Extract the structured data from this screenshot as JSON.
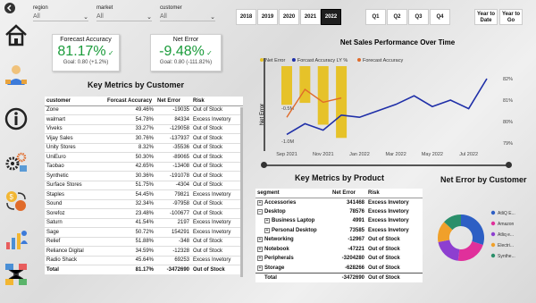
{
  "filters": [
    {
      "label": "region",
      "value": "All"
    },
    {
      "label": "market",
      "value": "All"
    },
    {
      "label": "customer",
      "value": "All"
    }
  ],
  "years": [
    "2018",
    "2019",
    "2020",
    "2021",
    "2022"
  ],
  "selected_year": "2022",
  "quarters": [
    "Q1",
    "Q2",
    "Q3",
    "Q4"
  ],
  "period_buttons": [
    "Year to Date",
    "Year to Go"
  ],
  "nav": [
    "back-icon",
    "home-icon",
    "user-icon",
    "info-icon",
    "gears-icon",
    "money-exchange-icon",
    "people-chart-icon",
    "network-icon"
  ],
  "kpis": {
    "forecast_accuracy": {
      "title": "Forecast Accuracy",
      "value": "81.17%",
      "goal": "Goal: 0.80 (+1.2%)",
      "color": "#1a9b3a"
    },
    "net_error": {
      "title": "Net Error",
      "value": "-9.48%",
      "goal": "Goal: 0.80 (-111.82%)",
      "color": "#1a9b3a"
    }
  },
  "customer_table": {
    "title": "Key Metrics by Customer",
    "headers": [
      "customer",
      "Forcast Accuracy",
      "Net Error",
      "Risk"
    ],
    "rows": [
      [
        "Zone",
        "49.46%",
        "-19035",
        "Out of Stock"
      ],
      [
        "walmart",
        "54.78%",
        "84334",
        "Excess Invetory"
      ],
      [
        "Viveks",
        "33.27%",
        "-129058",
        "Out of Stock"
      ],
      [
        "Vijay Sales",
        "30.76%",
        "-137937",
        "Out of Stock"
      ],
      [
        "Unity Stores",
        "8.32%",
        "-35536",
        "Out of Stock"
      ],
      [
        "UniEuro",
        "50.30%",
        "-89065",
        "Out of Stock"
      ],
      [
        "Taobao",
        "42.65%",
        "-13408",
        "Out of Stock"
      ],
      [
        "Synthetic",
        "30.36%",
        "-191078",
        "Out of Stock"
      ],
      [
        "Surface Stores",
        "51.75%",
        "-4304",
        "Out of Stock"
      ],
      [
        "Staples",
        "54.45%",
        "79821",
        "Excess Invetory"
      ],
      [
        "Sound",
        "32.34%",
        "-97958",
        "Out of Stock"
      ],
      [
        "Sorefoz",
        "23.48%",
        "-100677",
        "Out of Stock"
      ],
      [
        "Saturn",
        "41.54%",
        "2197",
        "Excess Invetory"
      ],
      [
        "Sage",
        "50.72%",
        "154291",
        "Excess Invetory"
      ],
      [
        "Relief",
        "51.88%",
        "-348",
        "Out of Stock"
      ],
      [
        "Reliance Digital",
        "34.59%",
        "-12328",
        "Out of Stock"
      ],
      [
        "Radio Shack",
        "45.64%",
        "69253",
        "Excess Invetory"
      ]
    ],
    "total": [
      "Total",
      "81.17%",
      "-3472690",
      "Out of Stock"
    ]
  },
  "product_table": {
    "title": "Key Metrics by Product",
    "headers": [
      "segment",
      "Net Error",
      "Risk"
    ],
    "rows": [
      {
        "name": "Accessories",
        "indent": 0,
        "expander": "+",
        "net_error": "341468",
        "risk": "Excess Invetory"
      },
      {
        "name": "Desktop",
        "indent": 0,
        "expander": "−",
        "net_error": "78576",
        "risk": "Excess Invetory"
      },
      {
        "name": "Business Laptop",
        "indent": 1,
        "expander": "+",
        "net_error": "4991",
        "risk": "Excess Invetory"
      },
      {
        "name": "Personal Desktop",
        "indent": 1,
        "expander": "+",
        "net_error": "73585",
        "risk": "Excess Invetory"
      },
      {
        "name": "Networking",
        "indent": 0,
        "expander": "+",
        "net_error": "-12967",
        "risk": "Out of Stock"
      },
      {
        "name": "Notebook",
        "indent": 0,
        "expander": "+",
        "net_error": "-47221",
        "risk": "Out of Stock"
      },
      {
        "name": "Peripherals",
        "indent": 0,
        "expander": "+",
        "net_error": "-3204280",
        "risk": "Out of Stock"
      },
      {
        "name": "Storage",
        "indent": 0,
        "expander": "+",
        "net_error": "-628266",
        "risk": "Out of Stock"
      }
    ],
    "total": {
      "name": "Total",
      "net_error": "-3472690",
      "risk": "Out of Stock"
    }
  },
  "chart_data": [
    {
      "type": "bar",
      "title": "Net Sales Performance Over Time",
      "legend": [
        "Net Error",
        "Forcast Accuracy LY %",
        "Forecast Accuracy"
      ],
      "legend_colors": [
        "#e6c229",
        "#1f2fa8",
        "#e06b2a"
      ],
      "x_ticks": [
        "Sep 2021",
        "Nov 2021",
        "Jan 2022",
        "Mar 2022",
        "May 2022",
        "Jul 2022"
      ],
      "ylabel": "Net Error",
      "y_left_ticks": [
        "0.0M",
        "-0.5M",
        "-1.0M"
      ],
      "y_right_ticks": [
        "82%",
        "81%",
        "80%",
        "79%"
      ],
      "net_error_bars": {
        "x": [
          "Sep 2021",
          "Oct 2021",
          "Nov 2021",
          "Dec 2021"
        ],
        "values": [
          -0.45,
          -0.42,
          -0.75,
          -0.95
        ]
      },
      "forecast_accuracy_ly": {
        "x": [
          "Sep 2021",
          "Oct 2021",
          "Nov 2021",
          "Dec 2021",
          "Jan 2022",
          "Feb 2022",
          "Mar 2022",
          "Apr 2022",
          "May 2022",
          "Jun 2022",
          "Jul 2022",
          "Aug 2022"
        ],
        "values": [
          79.4,
          79.9,
          79.6,
          80.3,
          80.2,
          80.5,
          80.8,
          81.2,
          80.7,
          81.0,
          80.6,
          82.0
        ]
      },
      "forecast_accuracy": {
        "x": [
          "Sep 2021",
          "Oct 2021",
          "Nov 2021",
          "Dec 2021"
        ],
        "values": [
          80.2,
          81.5,
          80.9,
          81.1
        ]
      }
    },
    {
      "type": "pie",
      "title": "Net Error by Customer",
      "labels": [
        "AtliQ E...",
        "Amazon",
        "Atliq e...",
        "Electri...",
        "Synthe..."
      ],
      "values": [
        30,
        22,
        20,
        15,
        13
      ],
      "colors": [
        "#2d5fc4",
        "#e0309b",
        "#8d3fd0",
        "#f0a02a",
        "#2a8f6a"
      ]
    }
  ]
}
